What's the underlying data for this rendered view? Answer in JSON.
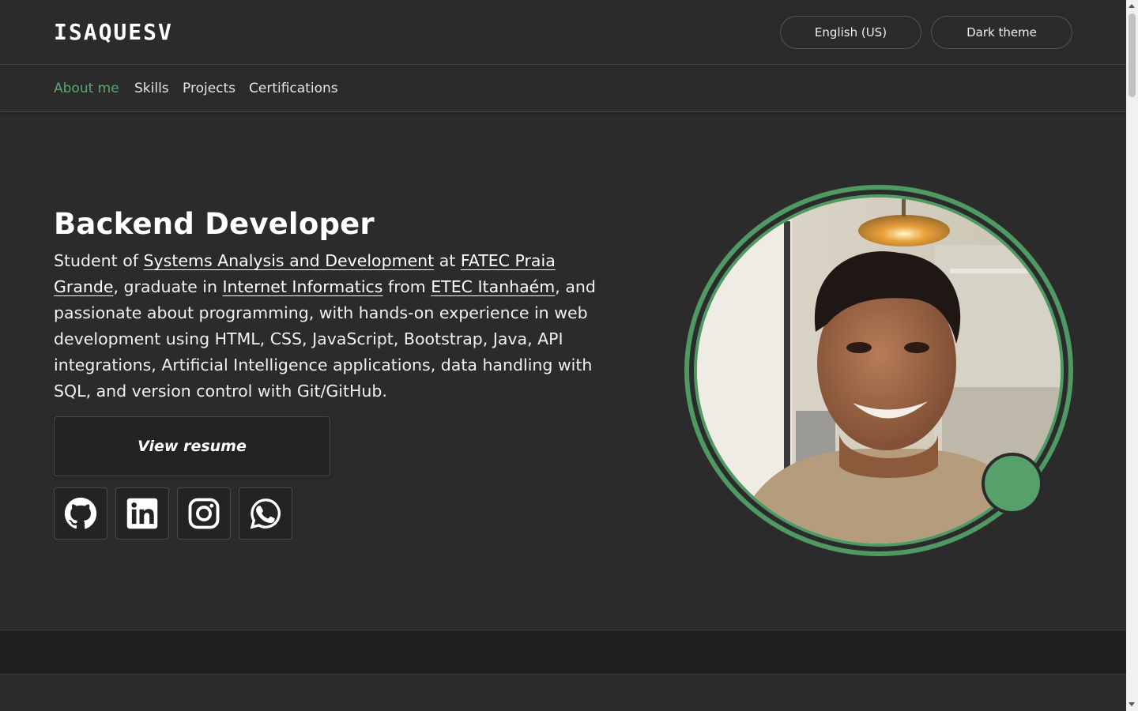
{
  "header": {
    "brand": "ISAQUESV",
    "language_label": "English (US)",
    "theme_label": "Dark theme"
  },
  "nav": {
    "items": [
      {
        "label": "About me",
        "active": true
      },
      {
        "label": "Skills",
        "active": false
      },
      {
        "label": "Projects",
        "active": false
      },
      {
        "label": "Certifications",
        "active": false
      }
    ]
  },
  "hero": {
    "title": "Backend Developer",
    "text": {
      "t1": "Student of ",
      "course": "Systems Analysis and Development",
      "t2": " at ",
      "college": "FATEC Praia Grande",
      "t3": ", graduate in ",
      "program": "Internet Informatics",
      "t4": " from ",
      "school": "ETEC Itanhaém",
      "t5": ", and passionate about programming, with hands-on experience in web development using HTML, CSS, JavaScript, Bootstrap, Java, API integrations, Artificial Intelligence applications, data handling with SQL, and version control with Git/GitHub."
    },
    "resume_button": "View resume",
    "social": [
      {
        "icon": "github-icon"
      },
      {
        "icon": "linkedin-icon"
      },
      {
        "icon": "instagram-icon"
      },
      {
        "icon": "whatsapp-icon"
      }
    ]
  },
  "colors": {
    "accent": "#5fa472",
    "ring": "#4f9a63",
    "background": "#2b2b2b",
    "button_bg": "#232323"
  }
}
